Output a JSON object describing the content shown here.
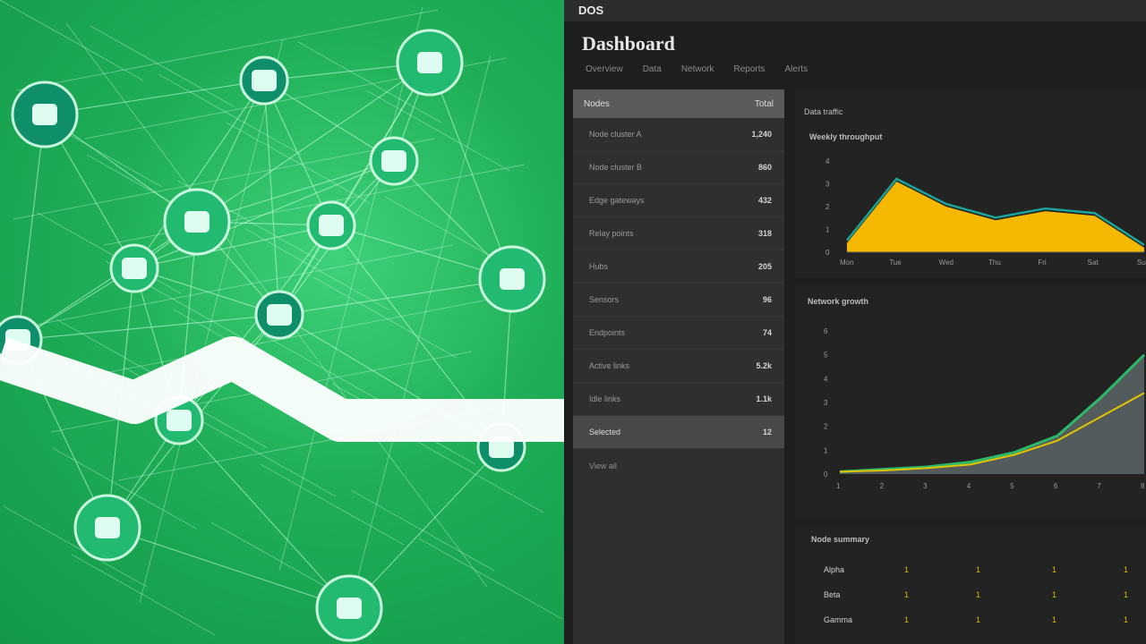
{
  "dashboard": {
    "app_name": "DOS",
    "title": "Dashboard",
    "tabs": [
      "Overview",
      "Data",
      "Network",
      "Reports",
      "Alerts"
    ]
  },
  "sidebar": {
    "header": {
      "label": "Nodes",
      "value": "Total"
    },
    "items": [
      {
        "label": "Node cluster A",
        "value": "1,240"
      },
      {
        "label": "Node cluster B",
        "value": "860"
      },
      {
        "label": "Edge gateways",
        "value": "432"
      },
      {
        "label": "Relay points",
        "value": "318"
      },
      {
        "label": "Hubs",
        "value": "205"
      },
      {
        "label": "Sensors",
        "value": "96"
      },
      {
        "label": "Endpoints",
        "value": "74"
      },
      {
        "label": "Active links",
        "value": "5.2k"
      },
      {
        "label": "Idle links",
        "value": "1.1k"
      },
      {
        "label": "Selected",
        "value": "12"
      }
    ],
    "footer": "View all"
  },
  "panels": {
    "p1_title": "Data traffic",
    "p1_sub": "Weekly throughput",
    "p2_title": "Network growth",
    "p3_title": "Node summary"
  },
  "chart_data": [
    {
      "type": "area",
      "x": [
        "Mon",
        "Tue",
        "Wed",
        "Thu",
        "Fri",
        "Sat",
        "Sun"
      ],
      "ylim": [
        0,
        4
      ],
      "series": [
        {
          "values": [
            0.4,
            3.1,
            2.0,
            1.4,
            1.8,
            1.6,
            0.2
          ]
        }
      ],
      "colors": [
        "#f5b800",
        "#1aa39a"
      ]
    },
    {
      "type": "line",
      "x": [
        "1",
        "2",
        "3",
        "4",
        "5",
        "6",
        "7",
        "8"
      ],
      "ylim": [
        0,
        6
      ],
      "series": [
        {
          "values": [
            0.1,
            0.2,
            0.3,
            0.5,
            0.9,
            1.6,
            3.2,
            5.0
          ]
        },
        {
          "values": [
            0.1,
            0.15,
            0.25,
            0.4,
            0.8,
            1.4,
            2.4,
            3.4
          ]
        }
      ],
      "colors": [
        "#2db86a",
        "#e0c400",
        "#5a6264"
      ]
    }
  ],
  "table": {
    "rows": [
      [
        "Alpha",
        "1",
        "1",
        "1",
        "1"
      ],
      [
        "Beta",
        "1",
        "1",
        "1",
        "1"
      ],
      [
        "Gamma",
        "1",
        "1",
        "1",
        "1"
      ]
    ]
  }
}
